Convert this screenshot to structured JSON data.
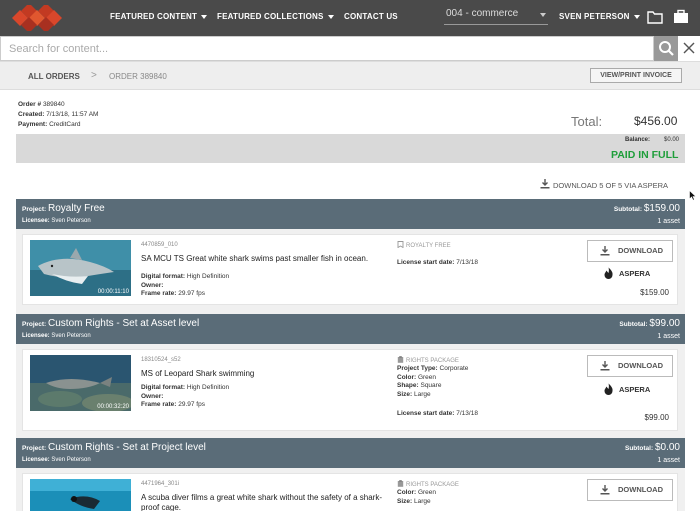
{
  "nav": {
    "featured_content": "FEATURED CONTENT",
    "featured_collections": "FEATURED COLLECTIONS",
    "contact_us": "CONTACT US",
    "account_select": "004 - commerce",
    "user_name": "SVEN PETERSON"
  },
  "search": {
    "placeholder": "Search for content..."
  },
  "breadcrumb": {
    "all_orders": "ALL ORDERS",
    "separator": ">",
    "current": "ORDER 389840"
  },
  "print_button": "VIEW/PRINT INVOICE",
  "order": {
    "number_label": "Order #",
    "number": "389840",
    "created_label": "Created:",
    "created": "7/13/18, 11:57 AM",
    "payment_label": "Payment:",
    "payment": "CreditCard",
    "total_label": "Total:",
    "total": "$456.00",
    "balance_label": "Balance:",
    "balance": "$0.00",
    "status": "PAID IN FULL"
  },
  "download_all": "DOWNLOAD 5 OF 5 VIA ASPERA",
  "projects": [
    {
      "project_label": "Project:",
      "name": "Royalty Free",
      "licensee_label": "Licensee:",
      "licensee": "Sven Peterson",
      "subtotal_label": "Subtotal:",
      "subtotal": "$159.00",
      "count": "1 asset",
      "asset": {
        "id": "4470859_010",
        "title": "SA MCU TS Great white shark swims past smaller fish in ocean.",
        "timecode": "00:00:11:10",
        "format_label": "Digital format:",
        "format": "High Definition",
        "owner_label": "Owner:",
        "owner": "",
        "frame_label": "Frame rate:",
        "frame_rate": "29.97 fps",
        "license_kind": "ROYALTY FREE",
        "license_start_label": "License start date:",
        "license_start": "7/13/18",
        "download": "DOWNLOAD",
        "aspera": "ASPERA",
        "price": "$159.00"
      }
    },
    {
      "project_label": "Project:",
      "name": "Custom Rights - Set at Asset level",
      "licensee_label": "Licensee:",
      "licensee": "Sven Peterson",
      "subtotal_label": "Subtotal:",
      "subtotal": "$99.00",
      "count": "1 asset",
      "asset": {
        "id": "18310524_s52",
        "title": "MS of Leopard Shark swimming",
        "timecode": "00:00:32:20",
        "format_label": "Digital format:",
        "format": "High Definition",
        "owner_label": "Owner:",
        "owner": "",
        "frame_label": "Frame rate:",
        "frame_rate": "29.97 fps",
        "license_kind": "RIGHTS PACKAGE",
        "project_type_label": "Project Type:",
        "project_type": "Corporate",
        "color_label": "Color:",
        "color": "Green",
        "shape_label": "Shape:",
        "shape": "Square",
        "size_label": "Size:",
        "size": "Large",
        "license_start_label": "License start date:",
        "license_start": "7/13/18",
        "download": "DOWNLOAD",
        "aspera": "ASPERA",
        "price": "$99.00"
      }
    },
    {
      "project_label": "Project:",
      "name": "Custom Rights - Set at Project level",
      "licensee_label": "Licensee:",
      "licensee": "Sven Peterson",
      "subtotal_label": "Subtotal:",
      "subtotal": "$0.00",
      "count": "1 asset",
      "asset": {
        "id": "4471964_301i",
        "title": "A scuba diver films a great white shark without the safety of a shark-proof cage.",
        "license_kind": "RIGHTS PACKAGE",
        "color_label": "Color:",
        "color": "Green",
        "size_label": "Size:",
        "size": "Large",
        "download": "DOWNLOAD"
      }
    }
  ],
  "colors": {
    "header_bg": "#4a4a4a",
    "project_band": "#5a6c78",
    "paid_green": "#1e9e3a",
    "logo_red": "#d9472b"
  }
}
